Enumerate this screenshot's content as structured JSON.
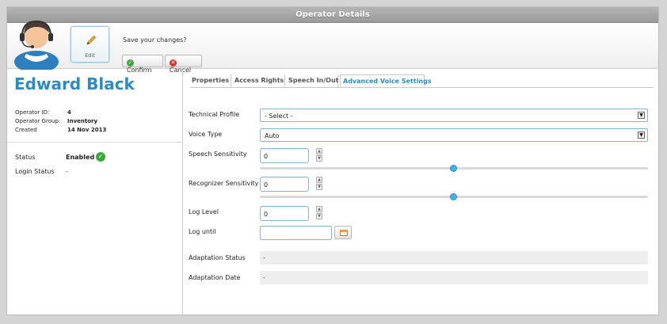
{
  "window": {
    "title": "Operator Details"
  },
  "toolbar": {
    "edit_label": "Edit",
    "save_question": "Save your changes?",
    "confirm_label": "Confirm",
    "cancel_label": "Cancel"
  },
  "operator": {
    "name": "Edward Black",
    "id_label": "Operator ID:",
    "id_value": "4",
    "group_label": "Operator Group:",
    "group_value": "Inventory",
    "created_label": "Created",
    "created_value": "14 Nov 2013",
    "status_label": "Status",
    "status_value": "Enabled",
    "login_status_label": "Login Status",
    "login_status_value": "-"
  },
  "tabs": [
    {
      "label": "Properties",
      "active": false
    },
    {
      "label": "Access Rights",
      "active": false
    },
    {
      "label": "Speech In/Out",
      "active": false
    },
    {
      "label": "Advanced Voice Settings",
      "active": true
    }
  ],
  "form": {
    "technical_profile": {
      "label": "Technical Profile",
      "value": "- Select -"
    },
    "voice_type": {
      "label": "Voice Type",
      "value": "Auto"
    },
    "speech_sensitivity": {
      "label": "Speech Sensitivity",
      "value": "0",
      "slider_fraction": 0.5
    },
    "recognizer_sensitivity": {
      "label": "Recognizer Sensitivity",
      "value": "0",
      "slider_fraction": 0.5
    },
    "log_level": {
      "label": "Log Level",
      "value": "0"
    },
    "log_until": {
      "label": "Log until",
      "value": ""
    },
    "adaptation_status": {
      "label": "Adaptation Status",
      "value": "-"
    },
    "adaptation_date": {
      "label": "Adaptation Date",
      "value": "-"
    }
  },
  "colors": {
    "accent": "#2b8cc4",
    "confirm": "#3aa73a",
    "cancel": "#d9352b",
    "slider_thumb": "#4aaee0"
  },
  "icons": {
    "avatar": "operator-headset-avatar",
    "edit": "pencil-icon",
    "confirm": "checkmark-icon",
    "cancel": "close-icon",
    "status": "check-circle-icon",
    "spin_up": "chevron-up-icon",
    "spin_down": "chevron-down-icon",
    "date_picker": "calendar-icon"
  }
}
